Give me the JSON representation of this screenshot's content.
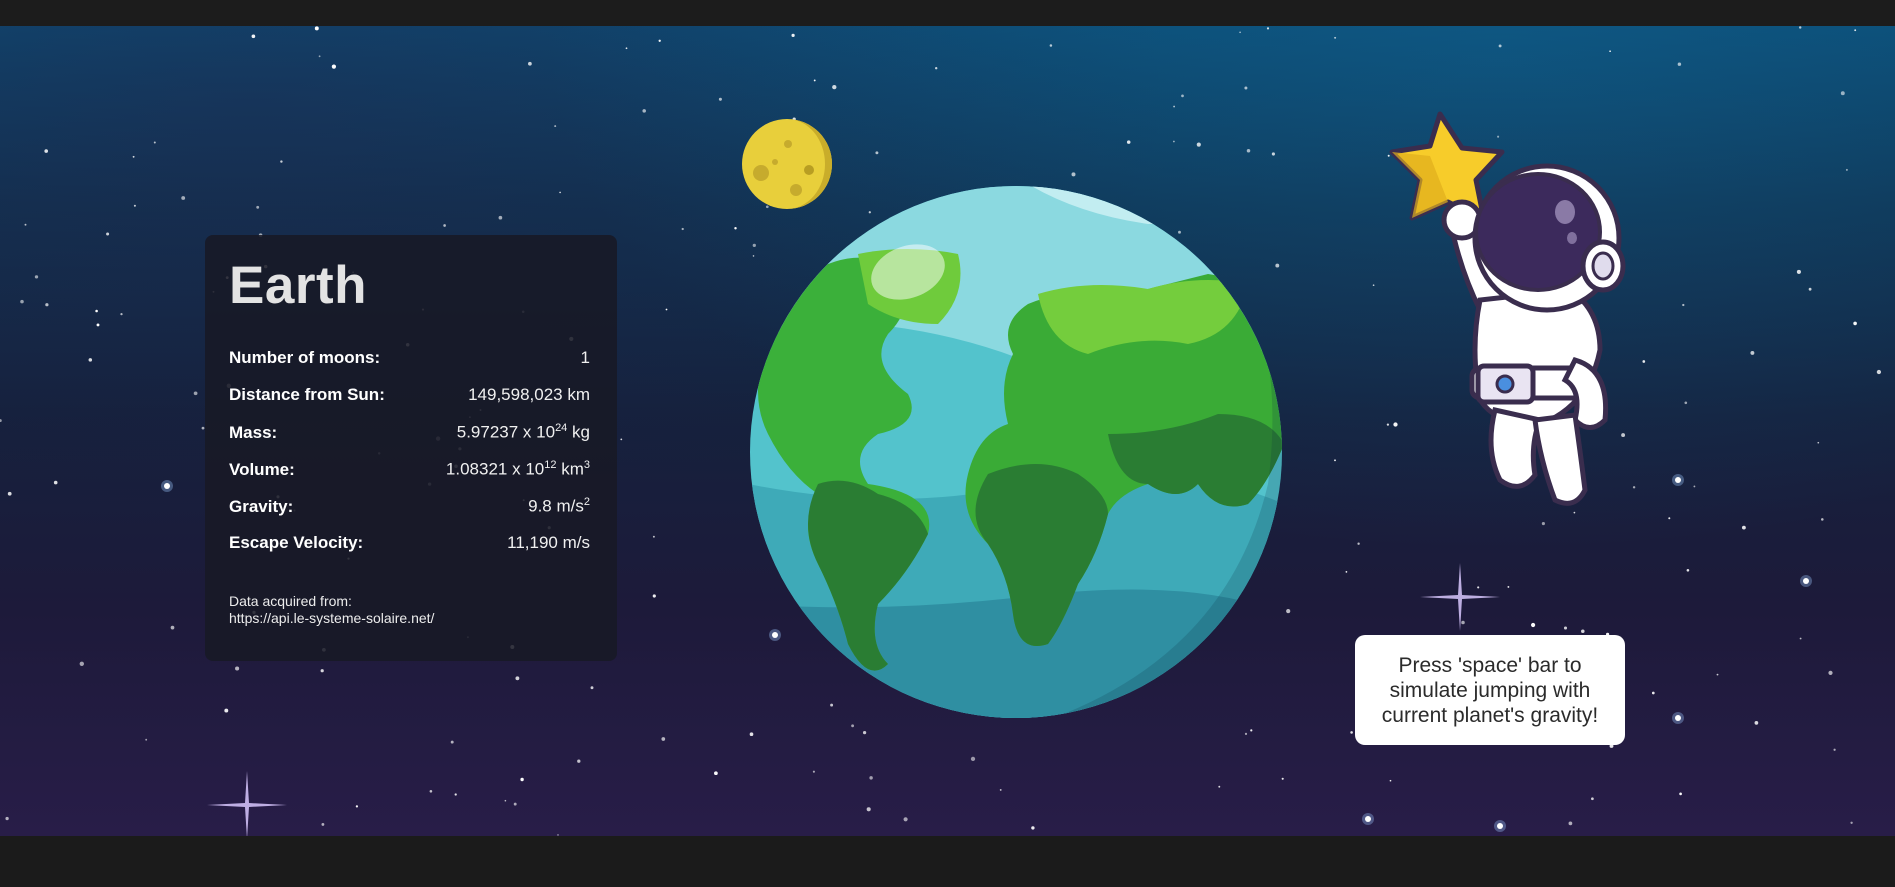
{
  "planet": {
    "name": "Earth",
    "stats": [
      {
        "label": "Number of moons:",
        "value": "1",
        "exp": "",
        "suffix": ""
      },
      {
        "label": "Distance from Sun:",
        "value": "149,598,023 km",
        "exp": "",
        "suffix": ""
      },
      {
        "label": "Mass:",
        "value": "5.97237 x 10",
        "exp": "24",
        "suffix": " kg"
      },
      {
        "label": "Volume:",
        "value": "1.08321 x 10",
        "exp": "12",
        "suffix": " km",
        "suffix_exp": "3"
      },
      {
        "label": "Gravity:",
        "value": "9.8 m/s",
        "exp": "2",
        "suffix": ""
      },
      {
        "label": "Escape Velocity:",
        "value": "11,190 m/s",
        "exp": "",
        "suffix": ""
      }
    ],
    "source_label": "Data acquired from:",
    "source_url": "https://api.le-systeme-solaire.net/"
  },
  "hint": {
    "text": "Press 'space' bar to simulate jumping with current planet's gravity!"
  },
  "illustrations": {
    "moon": "moon-icon",
    "planet": "earth-planet-image",
    "astronaut": "astronaut-with-star-image"
  },
  "colors": {
    "panel_bg": "#181926",
    "ocean": "#4fbcc8",
    "land": "#3aaa35",
    "moon": "#e7cf3a",
    "star": "#f7cc2a",
    "visor": "#3c2a5c"
  }
}
